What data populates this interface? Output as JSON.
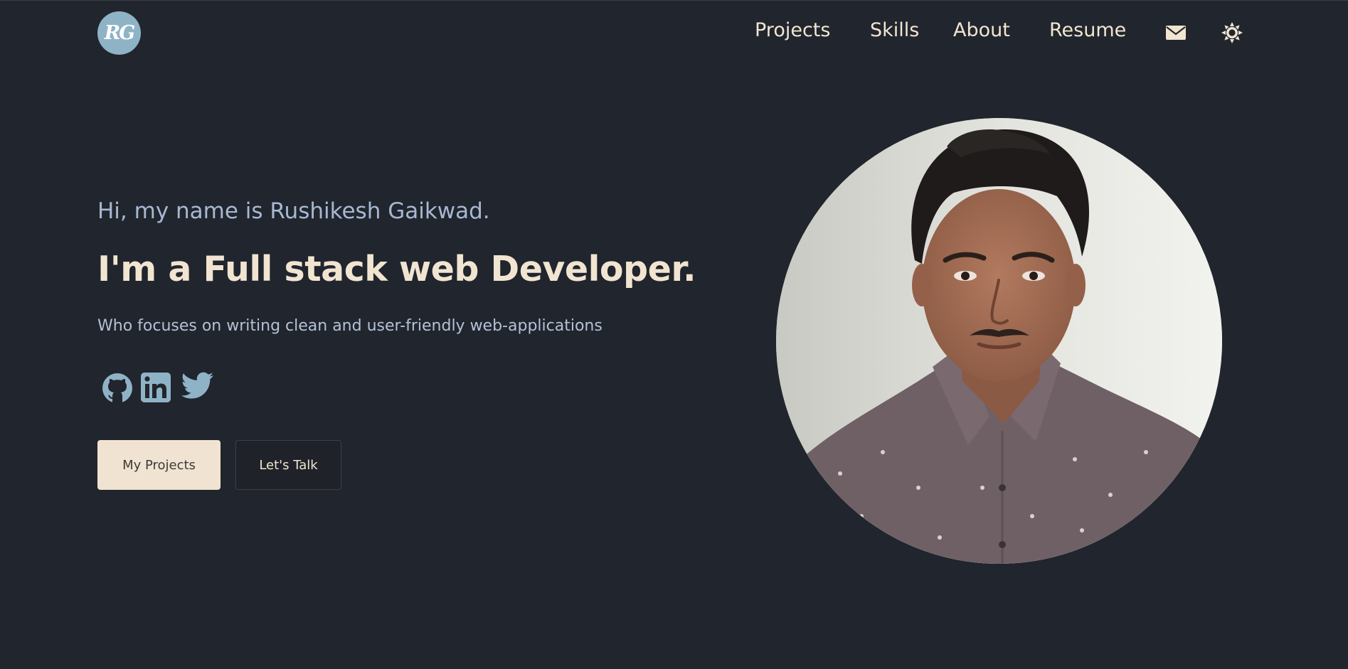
{
  "header": {
    "logo_text": "RG",
    "nav": {
      "projects": "Projects",
      "skills": "Skills",
      "about": "About",
      "resume": "Resume"
    },
    "icons": [
      "mail-icon",
      "sun-icon"
    ]
  },
  "hero": {
    "greeting": "Hi, my name is Rushikesh Gaikwad.",
    "headline": "I'm a Full stack web Developer.",
    "tagline": "Who focuses on writing clean and user-friendly web-applications",
    "social_icons": [
      "github-icon",
      "linkedin-icon",
      "twitter-icon"
    ],
    "primary_button": "My Projects",
    "secondary_button": "Let's Talk"
  },
  "colors": {
    "background": "#21252d",
    "accent_cream": "#f1e5d1",
    "muted_blue": "#a7b8d2",
    "icon_blue": "#8fb3c6"
  }
}
